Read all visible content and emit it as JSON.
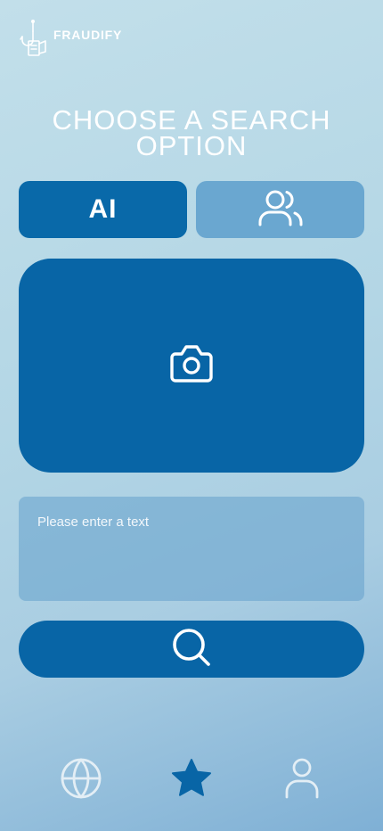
{
  "header": {
    "brand": "FRAUDIFY",
    "logo_icon": "fishing-hook-icon"
  },
  "page": {
    "title": "CHOOSE A SEARCH OPTION"
  },
  "toggle": {
    "ai_label": "AI",
    "ai_selected": true,
    "people_icon": "users-icon"
  },
  "upload": {
    "icon": "camera-icon"
  },
  "text_input": {
    "placeholder": "Please enter a text",
    "value": ""
  },
  "search": {
    "icon": "search-icon"
  },
  "bottom_nav": {
    "items": [
      {
        "icon": "globe-icon",
        "active": false
      },
      {
        "icon": "star-icon",
        "active": true
      },
      {
        "icon": "user-icon",
        "active": false
      }
    ]
  },
  "colors": {
    "primary": "#0865a6",
    "secondary": "#6aa7d0",
    "inactive_icon": "#e3eef5",
    "background_light": "#c2dfea",
    "background_dark": "#7fb0d5"
  }
}
